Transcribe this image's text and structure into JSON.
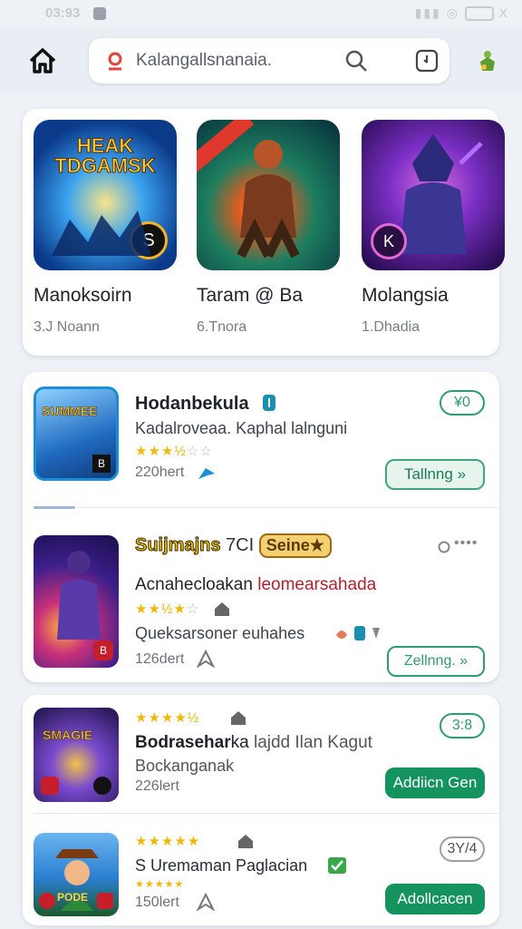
{
  "status": {
    "time": "03:93",
    "right": "▮▮▮  ◎  ",
    "x_label": "X"
  },
  "search": {
    "text": "Kalangallsnanaia."
  },
  "featured": [
    {
      "art_title": "HEAK\nTDGAMSK",
      "art_sub": "S",
      "title": "Manoksoirn",
      "sub": "3.J Noann",
      "colors": [
        "#0f4fb8",
        "#f5b428"
      ]
    },
    {
      "art_title": "",
      "art_sub": "",
      "title": "Taram @ Ba",
      "sub": "6.Tnora",
      "colors": [
        "#0b7a64",
        "#e55b1e"
      ]
    },
    {
      "art_title": "",
      "art_sub": "K",
      "title": "Molangsia",
      "sub": "1.Dhadia",
      "colors": [
        "#5a1fa3",
        "#d63aa8"
      ]
    }
  ],
  "list1": {
    "row1": {
      "thumb_label": "SUMMEE",
      "title": "Hodanbekula",
      "desc": "Kadalroveaa. Kaphal lalnguni",
      "rating": 3.5,
      "count": "220hert",
      "price": "¥0",
      "button": "Tallnng »"
    },
    "row2": {
      "title_gold": "Suijmajns",
      "title_extra": "7CI",
      "badge": "Seine★",
      "desc_black": "Acnahecloakan",
      "desc_red": "leomearsahada",
      "rating": 3.0,
      "extra": "Queksarsoner euhahes",
      "count": "126dert",
      "button": "Zellnng. »",
      "more": "••••"
    }
  },
  "list2": {
    "row1": {
      "thumb_label": "SMAGIE",
      "title": "Bodrasehar",
      "title_tail": "ka",
      "desc_tail": " lajdd Ilan Kagut",
      "sub": "Bockanganak",
      "rating": 4.5,
      "count": "226lert",
      "price": "3:8",
      "button": "Addiicn Gen"
    },
    "row2": {
      "thumb_label": "PODE",
      "title": "S Uremaman Paglacian",
      "rating": 5,
      "count": "150lert",
      "price": "3Y/4",
      "button": "Adollcacen"
    }
  },
  "accent": "#14935f"
}
